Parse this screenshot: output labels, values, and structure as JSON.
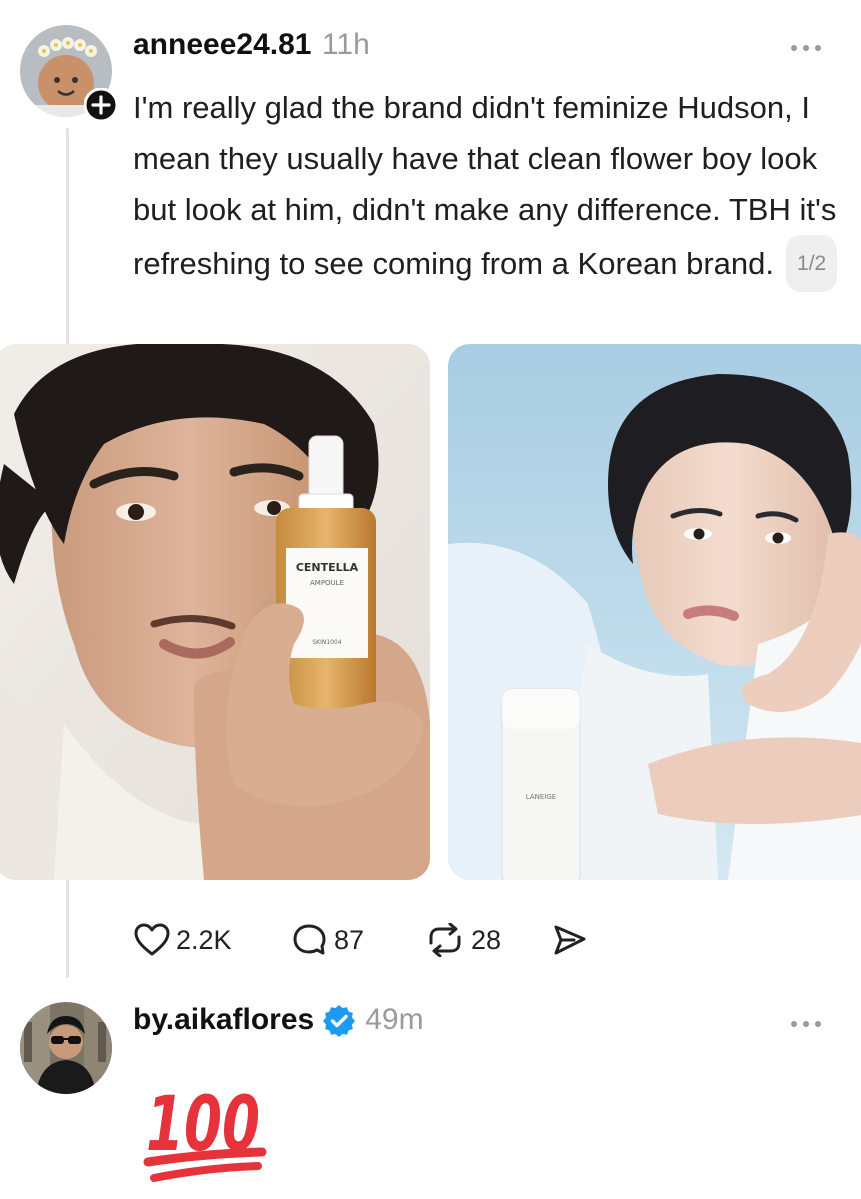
{
  "post": {
    "username": "anneee24.81",
    "time": "11h",
    "text": "I'm really glad the brand didn't feminize Hudson, I mean they usually have that clean flower boy look but look at him, didn't make any difference. TBH it's refreshing to see coming from a Korean brand.",
    "image_counter": "1/2",
    "images": [
      {
        "product_brand": "CENTELLA",
        "product_sub": "AMPOULE",
        "product_maker": "SKIN1004"
      },
      {
        "product_brand": "LANEIGE"
      }
    ],
    "actions": {
      "likes": "2.2K",
      "replies": "87",
      "reposts": "28"
    },
    "icons": [
      "more-icon",
      "follow-plus-icon",
      "heart-icon",
      "comment-icon",
      "repost-icon",
      "share-icon"
    ]
  },
  "reply": {
    "username": "by.aikaflores",
    "time": "49m",
    "verified": true,
    "emoji": "100",
    "emoji_color": "#e5323b",
    "verified_color": "#1d9bf0"
  }
}
